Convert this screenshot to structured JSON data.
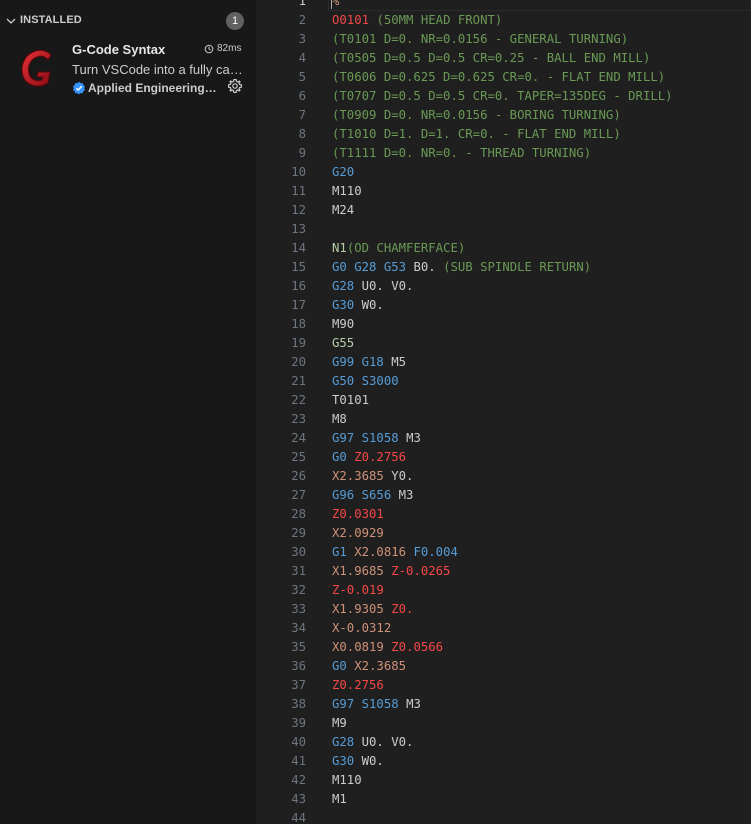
{
  "sidebar": {
    "section_title": "INSTALLED",
    "count": "1",
    "extension": {
      "name": "G-Code Syntax",
      "activation_time": "82ms",
      "description": "Turn VSCode into a fully capable G-Code editor",
      "publisher": "Applied Engineering & Design",
      "logo_letter": "G",
      "logo_color": "#c0141c"
    }
  },
  "editor": {
    "first_line_number": 1,
    "active_line": 1,
    "lines": [
      [
        [
          "p",
          "%"
        ]
      ],
      [
        [
          "o",
          "O0101"
        ],
        [
          "w",
          " "
        ],
        [
          "cm",
          "(50MM HEAD FRONT)"
        ]
      ],
      [
        [
          "cm",
          "(T0101 D=0. NR=0.0156 - GENERAL TURNING)"
        ]
      ],
      [
        [
          "cm",
          "(T0505 D=0.5 D=0.5 CR=0.25 - BALL END MILL)"
        ]
      ],
      [
        [
          "cm",
          "(T0606 D=0.625 D=0.625 CR=0. - FLAT END MILL)"
        ]
      ],
      [
        [
          "cm",
          "(T0707 D=0.5 D=0.5 CR=0. TAPER=135DEG - DRILL)"
        ]
      ],
      [
        [
          "cm",
          "(T0909 D=0. NR=0.0156 - BORING TURNING)"
        ]
      ],
      [
        [
          "cm",
          "(T1010 D=1. D=1. CR=0. - FLAT END MILL)"
        ]
      ],
      [
        [
          "cm",
          "(T1111 D=0. NR=0. - THREAD TURNING)"
        ]
      ],
      [
        [
          "g",
          "G20"
        ]
      ],
      [
        [
          "m",
          "M110"
        ]
      ],
      [
        [
          "m",
          "M24"
        ]
      ],
      [],
      [
        [
          "n",
          "N1"
        ],
        [
          "cm",
          "(OD CHAMFERFACE)"
        ]
      ],
      [
        [
          "g",
          "G0"
        ],
        [
          "w",
          " "
        ],
        [
          "g",
          "G28"
        ],
        [
          "w",
          " "
        ],
        [
          "g",
          "G53"
        ],
        [
          "w",
          " "
        ],
        [
          "t",
          "B0."
        ],
        [
          "w",
          " "
        ],
        [
          "cm",
          "(SUB SPINDLE RETURN)"
        ]
      ],
      [
        [
          "g",
          "G28"
        ],
        [
          "w",
          " "
        ],
        [
          "t",
          "U0."
        ],
        [
          "w",
          " "
        ],
        [
          "t",
          "V0."
        ]
      ],
      [
        [
          "g",
          "G30"
        ],
        [
          "w",
          " "
        ],
        [
          "t",
          "W0."
        ]
      ],
      [
        [
          "m",
          "M90"
        ]
      ],
      [
        [
          "n",
          "G55"
        ]
      ],
      [
        [
          "g",
          "G99"
        ],
        [
          "w",
          " "
        ],
        [
          "g",
          "G18"
        ],
        [
          "w",
          " "
        ],
        [
          "m",
          "M5"
        ]
      ],
      [
        [
          "g",
          "G50"
        ],
        [
          "w",
          " "
        ],
        [
          "s",
          "S3000"
        ]
      ],
      [
        [
          "t",
          "T0101"
        ]
      ],
      [
        [
          "m",
          "M8"
        ]
      ],
      [
        [
          "g",
          "G97"
        ],
        [
          "w",
          " "
        ],
        [
          "s",
          "S1058"
        ],
        [
          "w",
          " "
        ],
        [
          "m",
          "M3"
        ]
      ],
      [
        [
          "g",
          "G0"
        ],
        [
          "w",
          " "
        ],
        [
          "z",
          "Z0.2756"
        ]
      ],
      [
        [
          "x",
          "X2.3685"
        ],
        [
          "w",
          " "
        ],
        [
          "t",
          "Y0."
        ]
      ],
      [
        [
          "g",
          "G96"
        ],
        [
          "w",
          " "
        ],
        [
          "s",
          "S656"
        ],
        [
          "w",
          " "
        ],
        [
          "m",
          "M3"
        ]
      ],
      [
        [
          "z",
          "Z0.0301"
        ]
      ],
      [
        [
          "x",
          "X2.0929"
        ]
      ],
      [
        [
          "g",
          "G1"
        ],
        [
          "w",
          " "
        ],
        [
          "x",
          "X2.0816"
        ],
        [
          "w",
          " "
        ],
        [
          "f",
          "F0.004"
        ]
      ],
      [
        [
          "x",
          "X1.9685"
        ],
        [
          "w",
          " "
        ],
        [
          "z",
          "Z-0.0265"
        ]
      ],
      [
        [
          "z",
          "Z-0.019"
        ]
      ],
      [
        [
          "x",
          "X1.9305"
        ],
        [
          "w",
          " "
        ],
        [
          "z",
          "Z0."
        ]
      ],
      [
        [
          "x",
          "X-0.0312"
        ]
      ],
      [
        [
          "x",
          "X0.0819"
        ],
        [
          "w",
          " "
        ],
        [
          "z",
          "Z0.0566"
        ]
      ],
      [
        [
          "g",
          "G0"
        ],
        [
          "w",
          " "
        ],
        [
          "x",
          "X2.3685"
        ]
      ],
      [
        [
          "z",
          "Z0.2756"
        ]
      ],
      [
        [
          "g",
          "G97"
        ],
        [
          "w",
          " "
        ],
        [
          "s",
          "S1058"
        ],
        [
          "w",
          " "
        ],
        [
          "m",
          "M3"
        ]
      ],
      [
        [
          "m",
          "M9"
        ]
      ],
      [
        [
          "g",
          "G28"
        ],
        [
          "w",
          " "
        ],
        [
          "t",
          "U0."
        ],
        [
          "w",
          " "
        ],
        [
          "t",
          "V0."
        ]
      ],
      [
        [
          "g",
          "G30"
        ],
        [
          "w",
          " "
        ],
        [
          "t",
          "W0."
        ]
      ],
      [
        [
          "m",
          "M110"
        ]
      ],
      [
        [
          "m",
          "M1"
        ]
      ],
      []
    ]
  },
  "colors": {
    "comment": "#6a9955",
    "g_code": "#569cd6",
    "coordinate_x": "#ce9178",
    "coordinate_z": "#f44747",
    "program_number": "#f44747",
    "default_text": "#cccccc"
  }
}
